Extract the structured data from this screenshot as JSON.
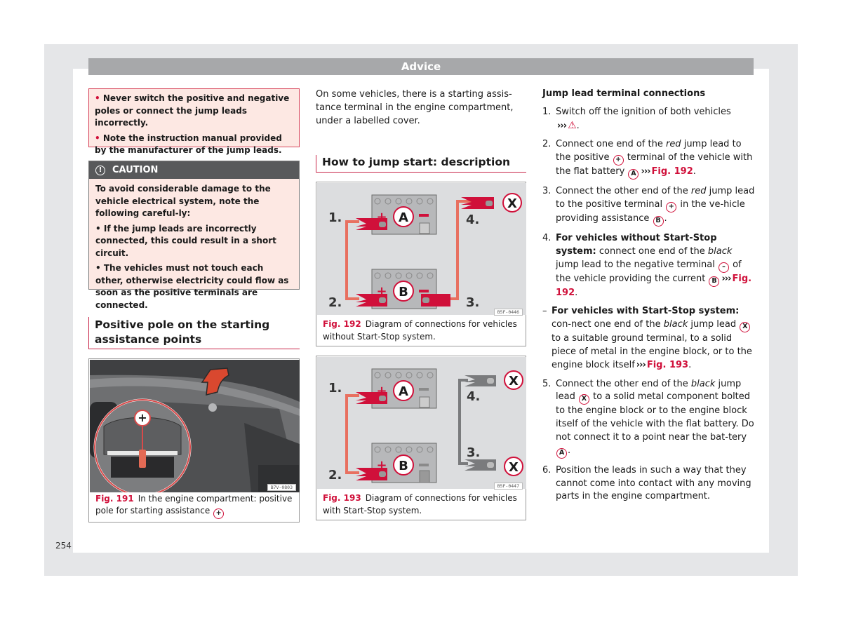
{
  "page_number": "254",
  "advice_bar": {
    "title": "Advice"
  },
  "warning_box": {
    "bullets": [
      "Never switch the positive and negative poles or connect the jump leads incorrectly.",
      "Note the instruction manual provided by the manufacturer of the jump leads."
    ]
  },
  "caution": {
    "icon": "exclamation-circle-icon",
    "title": "CAUTION",
    "intro": "To avoid considerable damage to the vehicle electrical system, note the following careful-ly:",
    "bullets": [
      "If the jump leads are incorrectly connected, this could result in a short circuit.",
      "The vehicles must not touch each other, otherwise electricity could flow as soon as the positive terminals are connected."
    ]
  },
  "section_positive_pole": {
    "title": "Positive pole on the starting assistance points"
  },
  "fig191": {
    "number": "Fig. 191",
    "caption": "In the engine compartment: positive pole for starting assistance",
    "symbol": "+",
    "code": "B7V-0803"
  },
  "intro_text": "On some vehicles, there is a starting assis-tance terminal in the engine compartment, under a labelled cover.",
  "section_how_to": {
    "title": "How to jump start: description"
  },
  "fig192": {
    "number": "Fig. 192",
    "caption": "Diagram of connections for vehicles without Start-Stop system.",
    "code": "B5F-0446",
    "labels": {
      "step1": "1.",
      "step2": "2.",
      "step3": "3.",
      "step4": "4.",
      "batteryA": "A",
      "batteryB": "B",
      "ground": "X",
      "plus": "+",
      "minus": "–"
    }
  },
  "fig193": {
    "number": "Fig. 193",
    "caption": "Diagram of connections for vehicles with Start-Stop system.",
    "code": "B5F-0447",
    "labels": {
      "step1": "1.",
      "step2": "2.",
      "step3": "3.",
      "step4": "4.",
      "batteryA": "A",
      "batteryB": "B",
      "ground": "X",
      "plus": "+",
      "minus": "–"
    }
  },
  "connections": {
    "title": "Jump lead terminal connections",
    "chevron": "›››",
    "steps": {
      "s1": {
        "num": "1.",
        "text": "Switch off the ignition of both vehicles"
      },
      "s2": {
        "num": "2.",
        "a": "Connect one end of the ",
        "em": "red",
        "b": " jump lead to the positive ",
        "c": " terminal of the vehicle with the flat battery ",
        "ref": "Fig. 192"
      },
      "s3": {
        "num": "3.",
        "a": "Connect the other end of the ",
        "em": "red",
        "b": " jump lead to the positive terminal ",
        "c": " in the ve-hicle providing assistance "
      },
      "s4": {
        "num": "4.",
        "bold": "For vehicles without Start-Stop system:",
        "a": " connect one end of the ",
        "em": "black",
        "b": " jump lead to the negative terminal ",
        "c": " of the vehicle providing the current ",
        "ref": "Fig. 192"
      },
      "s4b": {
        "num": "–",
        "bold": "For vehicles with Start-Stop system:",
        "a": " con-nect one end of the ",
        "em": "black",
        "b": " jump lead ",
        "c": " to a suitable ground terminal, to a solid piece of metal in the engine block, or to the engine block itself",
        "ref": "Fig. 193"
      },
      "s5": {
        "num": "5.",
        "a": "Connect the other end of the ",
        "em": "black",
        "b": " jump lead ",
        "c": " to a solid metal component bolted to the engine block or to the engine block itself of the vehicle with the flat battery. Do not connect it to a point near the bat-tery "
      },
      "s6": {
        "num": "6.",
        "text": "Position the leads in such a way that they cannot come into contact with any moving parts in the engine compartment."
      }
    },
    "symbols": {
      "plus": "+",
      "minus": "–",
      "A": "A",
      "B": "B",
      "X": "X"
    }
  },
  "colors": {
    "accent_red": "#d0103a",
    "warning_bg": "#fde8e3",
    "caution_header": "#58595b",
    "advice_bar": "#a7a8aa",
    "frame_gray": "#e5e6e8"
  }
}
